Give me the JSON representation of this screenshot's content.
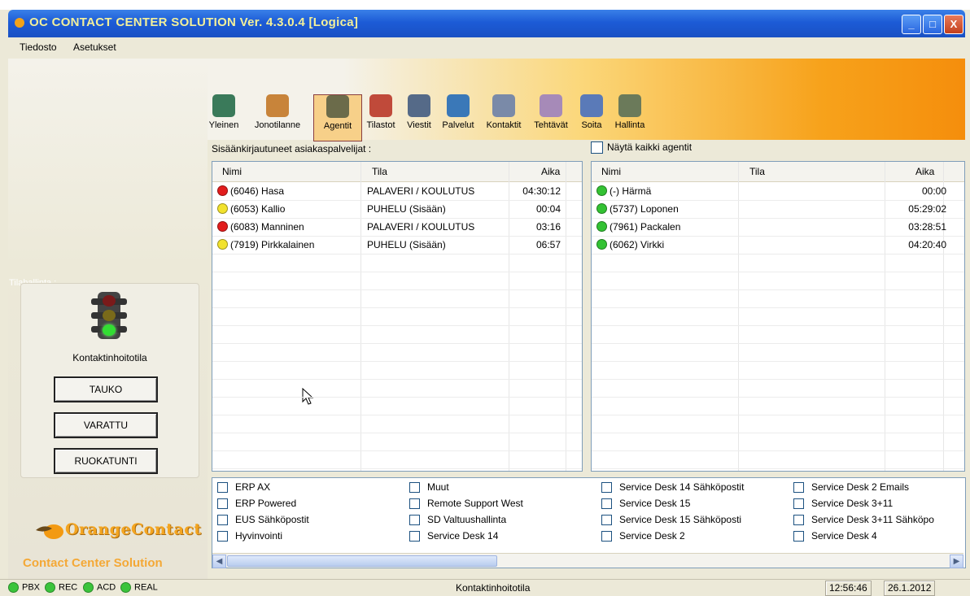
{
  "window": {
    "title": "OC CONTACT CENTER SOLUTION    Ver. 4.3.0.4  [Logica]",
    "buttons": [
      "_",
      "□",
      "X"
    ]
  },
  "menu": [
    "Tiedosto",
    "Asetukset"
  ],
  "toolbar": [
    {
      "label": "Yleinen",
      "icon": "general-icon",
      "color": "#3a7a5a"
    },
    {
      "label": "Jonotilanne",
      "icon": "queue-icon",
      "color": "#c8843a"
    },
    {
      "label": "Agentit",
      "icon": "agents-icon",
      "color": "#6b6b4a",
      "selected": true
    },
    {
      "label": "Tilastot",
      "icon": "stats-icon",
      "color": "#c04a3a"
    },
    {
      "label": "Viestit",
      "icon": "messages-icon",
      "color": "#556a88"
    },
    {
      "label": "Palvelut",
      "icon": "services-icon",
      "color": "#3a78b8"
    },
    {
      "label": "Kontaktit",
      "icon": "contacts-icon",
      "color": "#7a8aa8"
    },
    {
      "label": "Tehtävät",
      "icon": "tasks-icon",
      "color": "#a68ab8"
    },
    {
      "label": "Soita",
      "icon": "call-icon",
      "color": "#5a7ab8"
    },
    {
      "label": "Hallinta",
      "icon": "admin-icon",
      "color": "#6b7a5a"
    }
  ],
  "left_panel": {
    "section_label": "Tilahallinta :",
    "state_label": "Kontaktinhoitotila",
    "buttons": [
      "TAUKO",
      "VARATTU",
      "RUOKATUNTI"
    ],
    "brand_logo": "OrangeContact",
    "brand_tagline": "Contact Center Solution"
  },
  "logged_agents": {
    "header": "Sisäänkirjautuneet asiakaspalvelijat :",
    "columns": [
      "Nimi",
      "Tila",
      "Aika"
    ],
    "rows": [
      {
        "status": "#e21d1d",
        "name": "(6046) Hasa",
        "state": "PALAVERI / KOULUTUS",
        "time": "04:30:12"
      },
      {
        "status": "#f2e22d",
        "name": "(6053) Kallio",
        "state": "PUHELU (Sisään)",
        "time": "00:04"
      },
      {
        "status": "#e21d1d",
        "name": "(6083) Manninen",
        "state": "PALAVERI / KOULUTUS",
        "time": "03:16"
      },
      {
        "status": "#f2e22d",
        "name": "(7919) Pirkkalainen",
        "state": "PUHELU (Sisään)",
        "time": "06:57"
      }
    ]
  },
  "all_agents": {
    "checkbox_label": "Näytä kaikki agentit",
    "columns": [
      "Nimi",
      "Tila",
      "Aika"
    ],
    "rows": [
      {
        "status": "#33c233",
        "name": "(-) Härmä",
        "state": "",
        "time": "00:00"
      },
      {
        "status": "#33c233",
        "name": "(5737) Loponen",
        "state": "",
        "time": "05:29:02"
      },
      {
        "status": "#33c233",
        "name": "(7961) Packalen",
        "state": "",
        "time": "03:28:51"
      },
      {
        "status": "#33c233",
        "name": "(6062) Virkki",
        "state": "",
        "time": "04:20:40"
      }
    ]
  },
  "queues": [
    [
      "ERP AX",
      "ERP Powered",
      "EUS Sähköpostit",
      "Hyvinvointi"
    ],
    [
      "Muut",
      "Remote Support West",
      "SD Valtuushallinta",
      "Service Desk 14"
    ],
    [
      "Service Desk 14 Sähköpostit",
      "Service Desk 15",
      "Service Desk 15 Sähköposti",
      "Service Desk 2"
    ],
    [
      "Service Desk 2 Emails",
      "Service Desk 3+11",
      "Service Desk 3+11 Sähköpo",
      "Service Desk 4"
    ]
  ],
  "status_bar": {
    "indicators": [
      "PBX",
      "REC",
      "ACD",
      "REAL"
    ],
    "center": "Kontaktinhoitotila",
    "time": "12:56:46",
    "date": "26.1.2012"
  }
}
